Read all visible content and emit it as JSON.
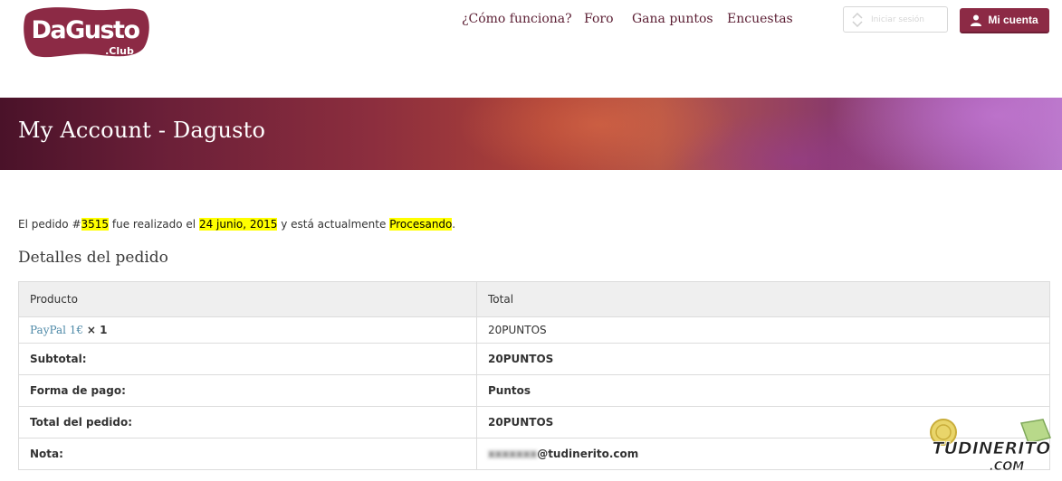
{
  "header": {
    "logo": {
      "primary": "DaGusto",
      "secondary": ".Club"
    },
    "nav": [
      {
        "label": "¿Cómo funciona?"
      },
      {
        "label": "Foro"
      },
      {
        "label": "Gana puntos"
      },
      {
        "label": "Encuestas"
      }
    ],
    "login_label": "Iniciar sesión",
    "account_label": "Mi cuenta"
  },
  "banner": {
    "title": "My Account - Dagusto"
  },
  "order": {
    "prefix": "El pedido #",
    "number": "3515",
    "mid": " fue realizado el ",
    "date": "24 junio, 2015",
    "mid2": " y está actualmente ",
    "status": "Procesando",
    "suffix": "."
  },
  "details": {
    "title": "Detalles del pedido",
    "headers": {
      "product": "Producto",
      "total": "Total"
    },
    "item": {
      "name": "PayPal 1€",
      "qty": "× 1",
      "total": "20PUNTOS"
    },
    "rows": [
      {
        "label": "Subtotal:",
        "value": "20PUNTOS"
      },
      {
        "label": "Forma de pago:",
        "value": "Puntos"
      },
      {
        "label": "Total del pedido:",
        "value": "20PUNTOS"
      },
      {
        "label": "Nota:",
        "value_hidden": "xxxxxxx",
        "value_domain": "@tudinerito.com"
      }
    ]
  },
  "watermark": {
    "top": "TUDINERITO",
    "bottom": ".COM"
  },
  "colors": {
    "brand": "#8c2a45",
    "nav_text": "#5b1e33",
    "link": "#4f8aa8",
    "highlight": "#ffff00"
  }
}
